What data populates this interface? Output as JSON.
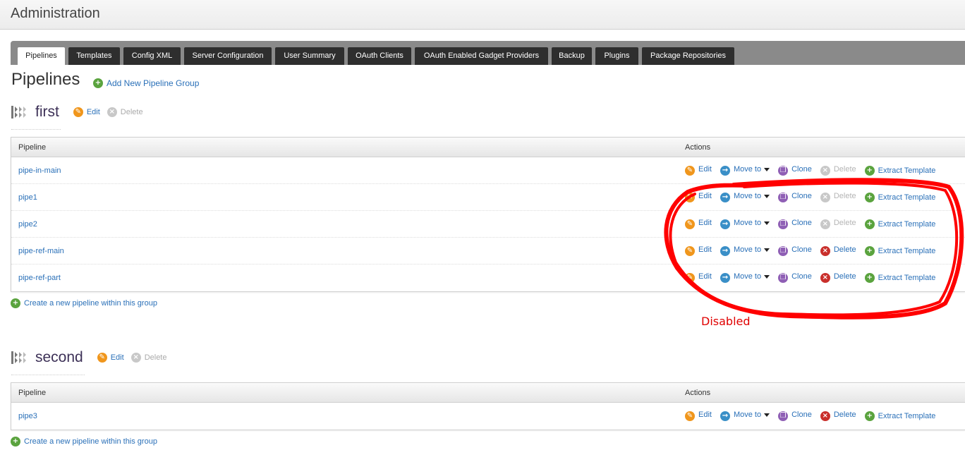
{
  "header": {
    "title": "Administration"
  },
  "tabs": [
    {
      "label": "Pipelines",
      "active": true
    },
    {
      "label": "Templates"
    },
    {
      "label": "Config XML"
    },
    {
      "label": "Server Configuration"
    },
    {
      "label": "User Summary"
    },
    {
      "label": "OAuth Clients"
    },
    {
      "label": "OAuth Enabled Gadget Providers"
    },
    {
      "label": "Backup"
    },
    {
      "label": "Plugins"
    },
    {
      "label": "Package Repositories"
    }
  ],
  "page": {
    "title": "Pipelines",
    "add_group_label": "Add New Pipeline Group"
  },
  "table_headers": {
    "pipeline": "Pipeline",
    "actions": "Actions"
  },
  "action_labels": {
    "edit": "Edit",
    "move_to": "Move to",
    "clone": "Clone",
    "delete": "Delete",
    "extract_template": "Extract Template"
  },
  "group_actions": {
    "edit": "Edit",
    "delete": "Delete"
  },
  "create_pipeline_label": "Create a new pipeline within this group",
  "groups": [
    {
      "name": "first",
      "pipelines": [
        {
          "name": "pipe-in-main",
          "delete_enabled": false
        },
        {
          "name": "pipe1",
          "delete_enabled": false
        },
        {
          "name": "pipe2",
          "delete_enabled": false
        },
        {
          "name": "pipe-ref-main",
          "delete_enabled": true
        },
        {
          "name": "pipe-ref-part",
          "delete_enabled": true
        }
      ]
    },
    {
      "name": "second",
      "pipelines": [
        {
          "name": "pipe3",
          "delete_enabled": true
        }
      ]
    }
  ],
  "annotation": {
    "text": "Disabled",
    "color": "#e00000"
  },
  "colors": {
    "link": "#2a70b8",
    "tab_dark": "#2e2e2e",
    "tab_bar": "#8a8a8a",
    "group_name": "#3d3157"
  }
}
